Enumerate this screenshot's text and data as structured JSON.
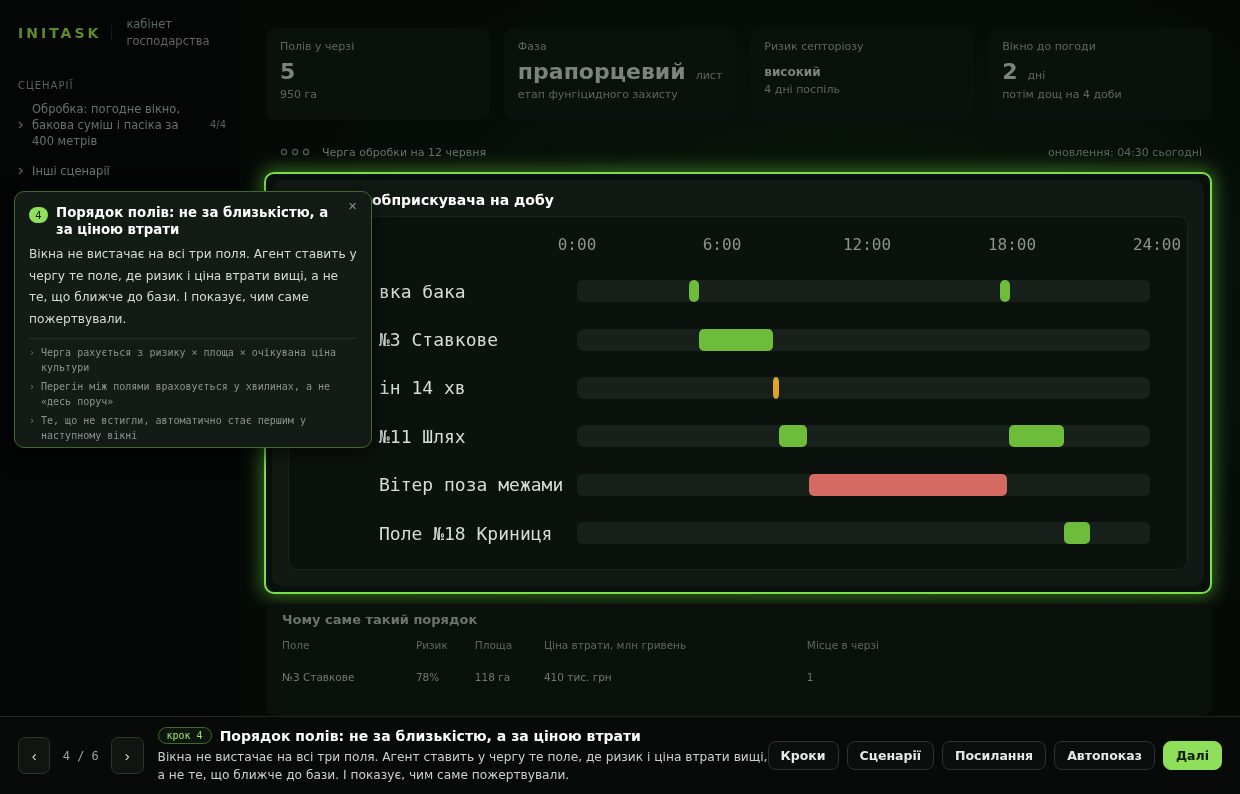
{
  "sidebar": {
    "logo": "INITASK",
    "subtitle": "кабінет господарства",
    "section": "СЦЕНАРІЇ",
    "items": [
      {
        "label": "Обробка: погодне вікно, бакова суміш і пасіка за 400 метрів",
        "count": "4/4"
      },
      {
        "label": "Інші сценарії"
      }
    ]
  },
  "stats": [
    {
      "label": "Полів у черзі",
      "value": "5",
      "note": "950 га"
    },
    {
      "label": "Фаза",
      "value": "прапорцевий",
      "unit": "лист",
      "note": "етап фунгіцидного захисту"
    },
    {
      "label": "Ризик септоріозу",
      "value": "високий",
      "note": "4 дні поспіль",
      "kind": "small"
    },
    {
      "label": "Вікно до погоди",
      "value": "2",
      "unit": "дні",
      "note": "потім дощ на 4 доби"
    }
  ],
  "queue": {
    "title": "Черга обробки на 12 червня",
    "updated": "оновлення: 04:30 сьогодні"
  },
  "schedule": {
    "title": "обприскувача на добу",
    "ticks": [
      "0:00",
      "6:00",
      "12:00",
      "18:00",
      "24:00"
    ],
    "rows": [
      {
        "label": "вка бака"
      },
      {
        "label": "№3 Ставкове"
      },
      {
        "label": "ін 14 хв"
      },
      {
        "label": "№11 Шлях"
      },
      {
        "label": "Вітер поза межами"
      },
      {
        "label": "Поле №18 Криниця"
      }
    ]
  },
  "reasons": {
    "title": "Чому саме такий порядок",
    "columns": [
      "Поле",
      "Ризик",
      "Площа",
      "Ціна втрати, млн гривень",
      "Місце в черзі"
    ],
    "rows": [
      [
        "№3 Ставкове",
        "78%",
        "118 га",
        "410 тис. грн",
        "1"
      ]
    ]
  },
  "tooltip": {
    "step": "4",
    "title": "Порядок полів: не за близькістю, а за ціною втрати",
    "close": "×",
    "body": "Вікна не вистачає на всі три поля. Агент ставить у чергу те поле, де ризик і ціна втрати вищі, а не те, що ближче до бази. І показує, чим саме пожертвували.",
    "bullets": [
      {
        "mark": "›",
        "text": "Черга рахується з ризику × площа × очікувана ціна культури"
      },
      {
        "mark": "›",
        "text": "Перегін між полями враховується у хвилинах, а не «десь поруч»"
      },
      {
        "mark": "›",
        "text": "Те, що не встигли, автоматично стає першим у наступному вікні"
      }
    ]
  },
  "tour": {
    "prev": "‹",
    "counter": "4 / 6",
    "next": "›",
    "badge": "крок 4",
    "title": "Порядок полів: не за близькістю, а за ціною втрати",
    "text": "Вікна не вистачає на всі три поля. Агент ставить у чергу те поле, де ризик і ціна втрати вищі, а не те, що ближче до бази. І показує, чим саме пожертвували.",
    "buttons": [
      {
        "label": "Кроки",
        "kind": "plain"
      },
      {
        "label": "Сценарії",
        "kind": "plain"
      },
      {
        "label": "Посилання",
        "kind": "plain"
      },
      {
        "label": "Автопоказ",
        "kind": "plain"
      },
      {
        "label": "Далі",
        "kind": "primary"
      }
    ]
  }
}
